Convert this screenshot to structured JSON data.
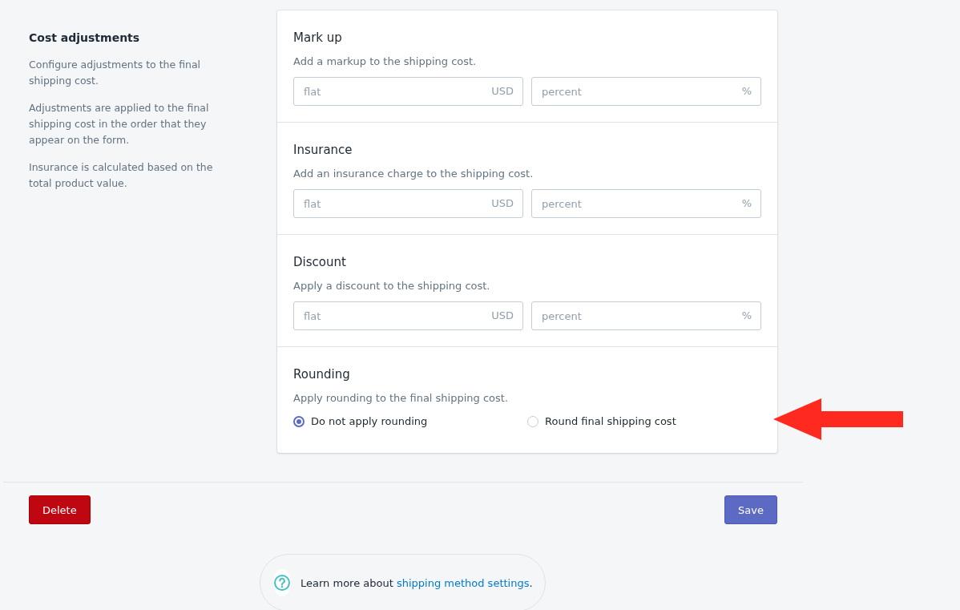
{
  "sidebar": {
    "title": "Cost adjustments",
    "paragraphs": [
      "Configure adjustments to the final shipping cost.",
      "Adjustments are applied to the final shipping cost in the order that they appear on the form.",
      "Insurance is calculated based on the total product value."
    ]
  },
  "sections": [
    {
      "kind": "fields",
      "title": "Mark up",
      "description": "Add a markup to the shipping cost.",
      "fields": [
        {
          "placeholder": "flat",
          "suffix": "USD"
        },
        {
          "placeholder": "percent",
          "suffix": "%"
        }
      ]
    },
    {
      "kind": "fields",
      "title": "Insurance",
      "description": "Add an insurance charge to the shipping cost.",
      "fields": [
        {
          "placeholder": "flat",
          "suffix": "USD"
        },
        {
          "placeholder": "percent",
          "suffix": "%"
        }
      ]
    },
    {
      "kind": "fields",
      "title": "Discount",
      "description": "Apply a discount to the shipping cost.",
      "fields": [
        {
          "placeholder": "flat",
          "suffix": "USD"
        },
        {
          "placeholder": "percent",
          "suffix": "%"
        }
      ]
    },
    {
      "kind": "radios",
      "title": "Rounding",
      "description": "Apply rounding to the final shipping cost.",
      "options": [
        {
          "label": "Do not apply rounding",
          "selected": true
        },
        {
          "label": "Round final shipping cost",
          "selected": false
        }
      ]
    }
  ],
  "buttons": {
    "delete": "Delete",
    "save": "Save"
  },
  "help": {
    "text": "Learn more about ",
    "link": "shipping method settings",
    "after": "."
  }
}
